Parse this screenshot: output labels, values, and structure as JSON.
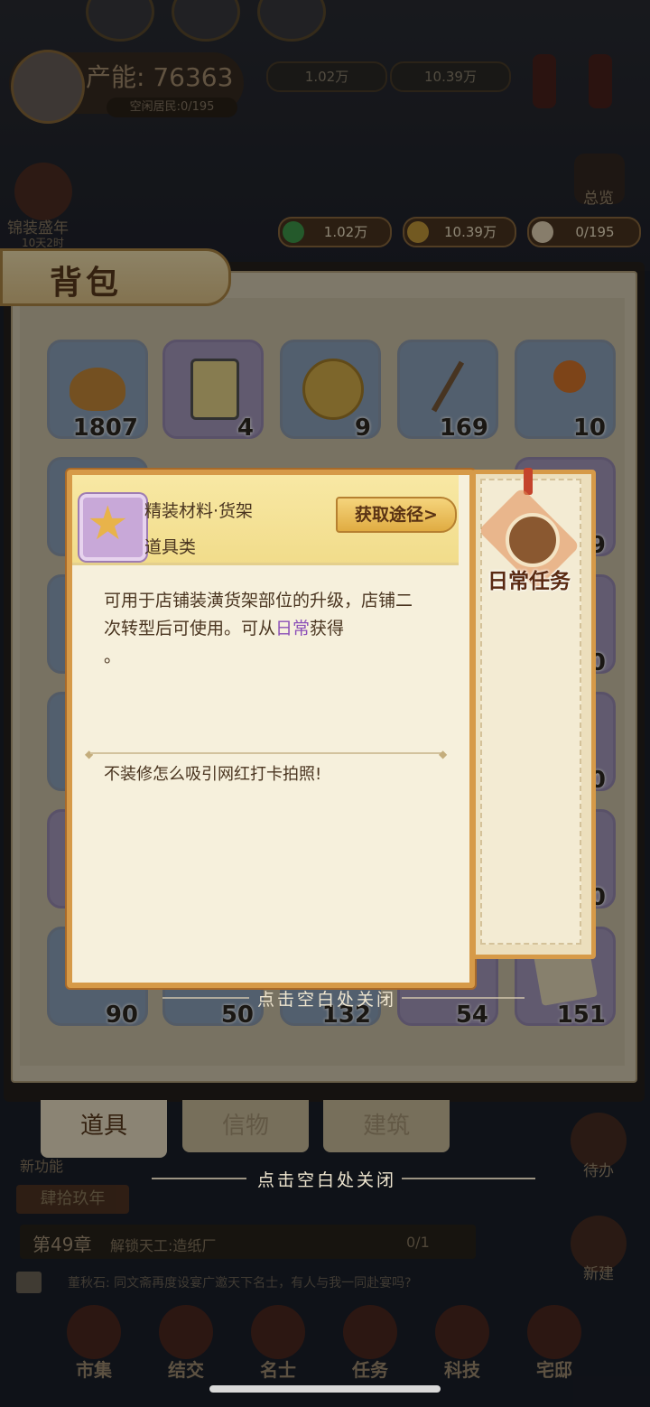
{
  "header": {
    "production_label": "产能: 76363",
    "resident_label": "空闲居民:0/195",
    "top_resources": [
      "1.02万",
      "10.39万"
    ],
    "overview_label": "总览",
    "event_label": "锦装盛年",
    "event_time": "10天2时"
  },
  "resources": {
    "silver": "1.02万",
    "copper": "10.39万",
    "residents": "0/195"
  },
  "backpack": {
    "title": "背包",
    "slots": [
      {
        "name": "bread-item",
        "count": "1807",
        "color": "blue"
      },
      {
        "name": "jar-item",
        "count": "4",
        "color": "purple"
      },
      {
        "name": "coin-item",
        "count": "9",
        "color": "blue"
      },
      {
        "name": "skewer-item",
        "count": "169",
        "color": "blue"
      },
      {
        "name": "candy-item",
        "count": "10",
        "color": "blue"
      }
    ],
    "partial_counts": [
      "9",
      "0",
      "0",
      "0"
    ],
    "bottom_counts": [
      "90",
      "50",
      "132",
      "54",
      "151"
    ],
    "tabs": [
      "道具",
      "信物",
      "建筑"
    ],
    "close_hint": "点击空白处关闭"
  },
  "popup": {
    "item_name": "精装材料·货架",
    "item_category": "道具类",
    "acquire_button": "获取途径>",
    "desc_part1": "可用于店铺装潢货架部位的升级，店铺二次转型后可使用。可从",
    "desc_highlight": "日常",
    "desc_part2": "获得",
    "desc_end": "。",
    "flavor": "不装修怎么吸引网红打卡拍照!",
    "close_hint": "点击空白处关闭",
    "source_tag": "日常任务"
  },
  "footer": {
    "new_feature": "新功能",
    "jobs_label": "肆拾玖年",
    "chapter_num": "第49章",
    "chapter_task": "解锁天工:造纸厂",
    "chapter_progress": "0/1",
    "news": "董秋石: 同文斋再度设宴广邀天下名士，有人与我一同赴宴吗?",
    "todo_label": "待办",
    "build_label": "新建",
    "nav": [
      "市集",
      "结交",
      "名士",
      "任务",
      "科技",
      "宅邸"
    ]
  }
}
